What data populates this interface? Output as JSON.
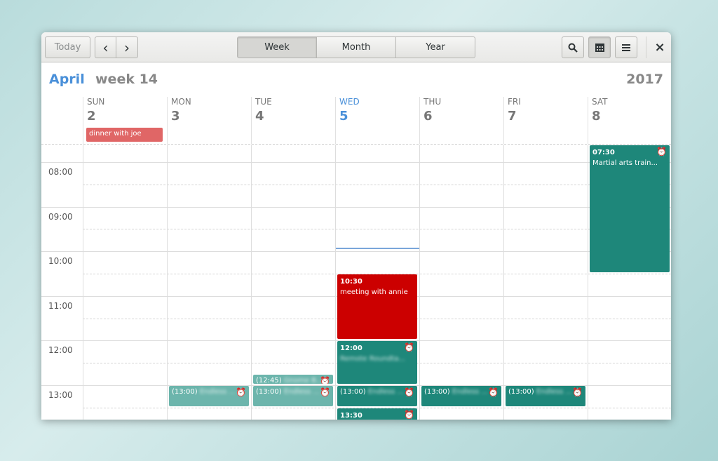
{
  "header": {
    "today": "Today",
    "prev": "‹",
    "next": "›",
    "views": [
      "Week",
      "Month",
      "Year"
    ],
    "active_view": "Week",
    "close": "×"
  },
  "title": {
    "month": "April",
    "week": "week 14",
    "year": "2017"
  },
  "days": [
    {
      "name": "SUN",
      "num": "2"
    },
    {
      "name": "MON",
      "num": "3"
    },
    {
      "name": "TUE",
      "num": "4"
    },
    {
      "name": "WED",
      "num": "5",
      "today": true
    },
    {
      "name": "THU",
      "num": "6"
    },
    {
      "name": "FRI",
      "num": "7"
    },
    {
      "name": "SAT",
      "num": "8"
    }
  ],
  "all_day": [
    {
      "day": 0,
      "title": "dinner with joe"
    }
  ],
  "hours": [
    "08:00",
    "09:00",
    "10:00",
    "11:00",
    "12:00",
    "13:00"
  ],
  "current_time": "09:55",
  "colors": {
    "accent": "#4a90d9",
    "teal": "#1e877a",
    "teal_past": "#6cb5ac",
    "red": "#cc0000",
    "allday": "#e06666"
  },
  "events": [
    {
      "day": 6,
      "start": "07:30",
      "end": "10:30",
      "time": "07:30",
      "title": "Martial arts train...",
      "color": "teal",
      "alarm": true,
      "layout": "block"
    },
    {
      "day": 3,
      "start": "10:30",
      "end": "12:00",
      "time": "10:30",
      "title": "meeting with annie",
      "color": "red",
      "alarm": false,
      "layout": "block"
    },
    {
      "day": 3,
      "start": "12:00",
      "end": "13:00",
      "time": "12:00",
      "title": "Remote Roundta...",
      "color": "teal",
      "alarm": true,
      "layout": "block",
      "blur": true
    },
    {
      "day": 2,
      "start": "12:45",
      "end": "13:00",
      "time": "(12:45)",
      "title": "Gnome B...",
      "color": "teal_past",
      "alarm": true,
      "layout": "inline",
      "blur": true
    },
    {
      "day": 1,
      "start": "13:00",
      "end": "13:30",
      "time": "(13:00)",
      "title": "Endless ...",
      "color": "teal_past",
      "alarm": true,
      "layout": "inline",
      "blur": true
    },
    {
      "day": 2,
      "start": "13:00",
      "end": "13:30",
      "time": "(13:00)",
      "title": "Endless ...",
      "color": "teal_past",
      "alarm": true,
      "layout": "inline",
      "blur": true
    },
    {
      "day": 3,
      "start": "13:00",
      "end": "13:30",
      "time": "(13:00)",
      "title": "Endless ...",
      "color": "teal",
      "alarm": true,
      "layout": "inline",
      "blur": true
    },
    {
      "day": 4,
      "start": "13:00",
      "end": "13:30",
      "time": "(13:00)",
      "title": "Endless ...",
      "color": "teal",
      "alarm": true,
      "layout": "inline",
      "blur": true
    },
    {
      "day": 5,
      "start": "13:00",
      "end": "13:30",
      "time": "(13:00)",
      "title": "Endless ...",
      "color": "teal",
      "alarm": true,
      "layout": "inline",
      "blur": true
    },
    {
      "day": 3,
      "start": "13:30",
      "end": "14:30",
      "time": "13:30",
      "title": "",
      "color": "teal",
      "alarm": true,
      "layout": "block"
    }
  ]
}
